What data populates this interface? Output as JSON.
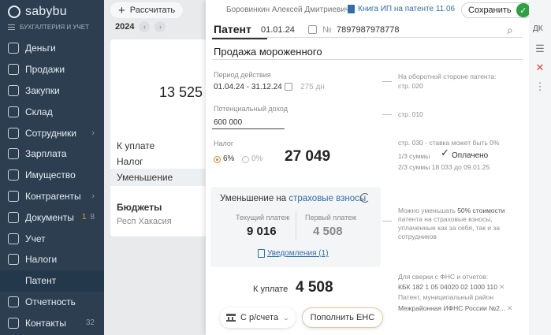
{
  "sidebar": {
    "brand": "sabybu",
    "subtitle": "БУХГАЛТЕРИЯ И УЧЕТ",
    "items": [
      {
        "label": "Деньги",
        "icon": "money-icon"
      },
      {
        "label": "Продажи",
        "icon": "sales-icon"
      },
      {
        "label": "Закупки",
        "icon": "purchases-icon"
      },
      {
        "label": "Склад",
        "icon": "warehouse-icon"
      },
      {
        "label": "Сотрудники",
        "icon": "employees-icon"
      },
      {
        "label": "Зарплата",
        "icon": "salary-icon"
      },
      {
        "label": "Имущество",
        "icon": "property-icon"
      },
      {
        "label": "Контрагенты",
        "icon": "contractors-icon"
      },
      {
        "label": "Документы",
        "icon": "documents-icon",
        "warn": "1",
        "count": "8"
      },
      {
        "label": "Учет",
        "icon": "accounting-icon"
      },
      {
        "label": "Налоги",
        "icon": "taxes-icon"
      },
      {
        "label": "Патент"
      },
      {
        "label": "Отчетность",
        "icon": "reports-icon"
      },
      {
        "label": "Контакты",
        "icon": "contacts-icon",
        "count": "32"
      }
    ]
  },
  "middle": {
    "calc_label": "Рассчитать",
    "year": "2024",
    "amount": "13 525",
    "rows": [
      "К уплате",
      "Налог",
      "Уменьшение"
    ],
    "budget_title": "Бюджеты",
    "budget_region": "Респ Хакасия"
  },
  "header": {
    "person": "Боровинкин Алексей Дмитриевич",
    "book": "Книга ИП на патенте 11.06",
    "save_label": "Сохранить"
  },
  "doc": {
    "title": "Патент",
    "date": "01.01.24",
    "num_sign": "№",
    "number": "7897987978778",
    "description": "Продажа мороженного"
  },
  "period": {
    "label": "Период действия",
    "value": "01.04.24 - 31.12.24",
    "days": "275 дн",
    "note": "На оборотной стороне патента:",
    "note2": "стр. 020"
  },
  "income": {
    "label": "Потенциальный доход",
    "value": "600 000",
    "note": "стр. 010"
  },
  "tax": {
    "label": "Налог",
    "rate1": "6%",
    "rate2": "0%",
    "amount": "27 049",
    "note": "стр. 030 - ставка может быть 0%",
    "third": "1/3 суммы",
    "paid": "Оплачено",
    "two_thirds": "2/3 суммы 18 033 до 09.01.25"
  },
  "reduction": {
    "title_prefix": "Уменьшение на",
    "title_link": "страховые взносы",
    "current_label": "Текущий платеж",
    "current_value": "9 016",
    "first_label": "Первый платеж",
    "first_value": "4 508",
    "notifications": "Уведомления (1)",
    "note1": "Можно уменьшать",
    "note1b": "50% стоимости",
    "note2": "патента на страховые взносы,",
    "note3": "уплаченные как за себя, так и за",
    "note4": "сотрудников"
  },
  "payment": {
    "label": "К уплате",
    "value": "4 508",
    "fns_note": "Для сверки с ФНС и отчетов:",
    "kbk": "КБК 182 1 05 04020 02 1000 110",
    "patent_note": "Патент, муниципальный район",
    "ifns": "Межрайонная ИФНС России №2..."
  },
  "actions": {
    "from_account": "С р/счета",
    "fill_ens": "Пополнить ЕНС"
  },
  "rail": {
    "dk": "ДК"
  }
}
